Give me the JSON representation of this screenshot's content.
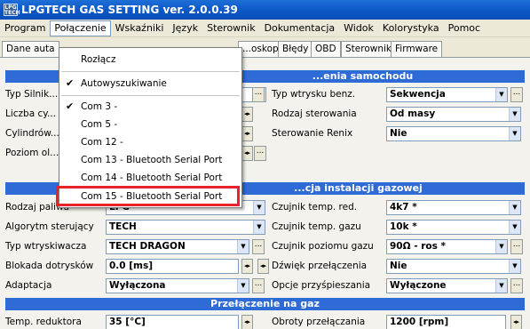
{
  "window": {
    "title": "LPGTECH GAS SETTING ver. 2.0.0.39",
    "icon_text": "LPG TECH"
  },
  "menubar": [
    "Program",
    "Połączenie",
    "Wskaźniki",
    "Język",
    "Sterownik",
    "Dokumentacja",
    "Widok",
    "Kolorystyka",
    "Pomoc"
  ],
  "tabs": [
    "Dane auta",
    "...oskop",
    "Błędy",
    "OBD",
    "Sterownik",
    "Firmware"
  ],
  "dropdown": {
    "items": [
      "Rozłącz",
      "Autowyszukiwanie",
      "Com 3 -",
      "Com 5 -",
      "Com 12 -",
      "Com 13 - Bluetooth Serial Port",
      "Com 14 - Bluetooth Serial Port",
      "Com 15 - Bluetooth Serial Port"
    ],
    "checked": [
      "Autowyszukiwanie",
      "Com 3 -"
    ],
    "highlighted": "Com 15 - Bluetooth Serial Port"
  },
  "sections": {
    "car": "...enia samochodu",
    "gas": "...cja instalacji gazowej",
    "switch": "Przełączenie na gaz"
  },
  "left_top": {
    "labels": [
      "Typ Silnik...",
      "Liczba cy...",
      "Cylindrów...",
      "Poziom ol..."
    ]
  },
  "right_top": [
    {
      "label": "Typ wtrysku benz.",
      "value": "Sekwencja"
    },
    {
      "label": "Rodzaj sterowania",
      "value": "Od masy"
    },
    {
      "label": "Sterowanie Renix",
      "value": "Nie"
    }
  ],
  "gas_left": [
    {
      "label": "Rodzaj paliwa",
      "value": "LPG"
    },
    {
      "label": "Algorytm sterujący",
      "value": "TECH"
    },
    {
      "label": "Typ wtryskiwacza",
      "value": "TECH DRAGON"
    },
    {
      "label": "Blokada dotrysków",
      "value": "0.0 [ms]"
    },
    {
      "label": "Adaptacja",
      "value": "Wyłączona"
    }
  ],
  "gas_right": [
    {
      "label": "Czujnik temp. red.",
      "value": "4k7 *"
    },
    {
      "label": "Czujnik temp. gazu",
      "value": "10k *"
    },
    {
      "label": "Czujnik poziomu gazu",
      "value": "90Ω - ros *"
    },
    {
      "label": "Dźwięk przełączenia",
      "value": "Nie"
    },
    {
      "label": "Opcje przyśpieszania",
      "value": "Wyłączone"
    }
  ],
  "switch_row": {
    "left_label": "Temp. reduktora",
    "left_value": "35 [°C]",
    "right_label": "Obroty przełączania",
    "right_value": "1200 [rpm]"
  },
  "colors": {
    "title_bar": "#0a55c4",
    "section_bar": "#2f6bd6",
    "highlight_box": "#e8242a"
  }
}
